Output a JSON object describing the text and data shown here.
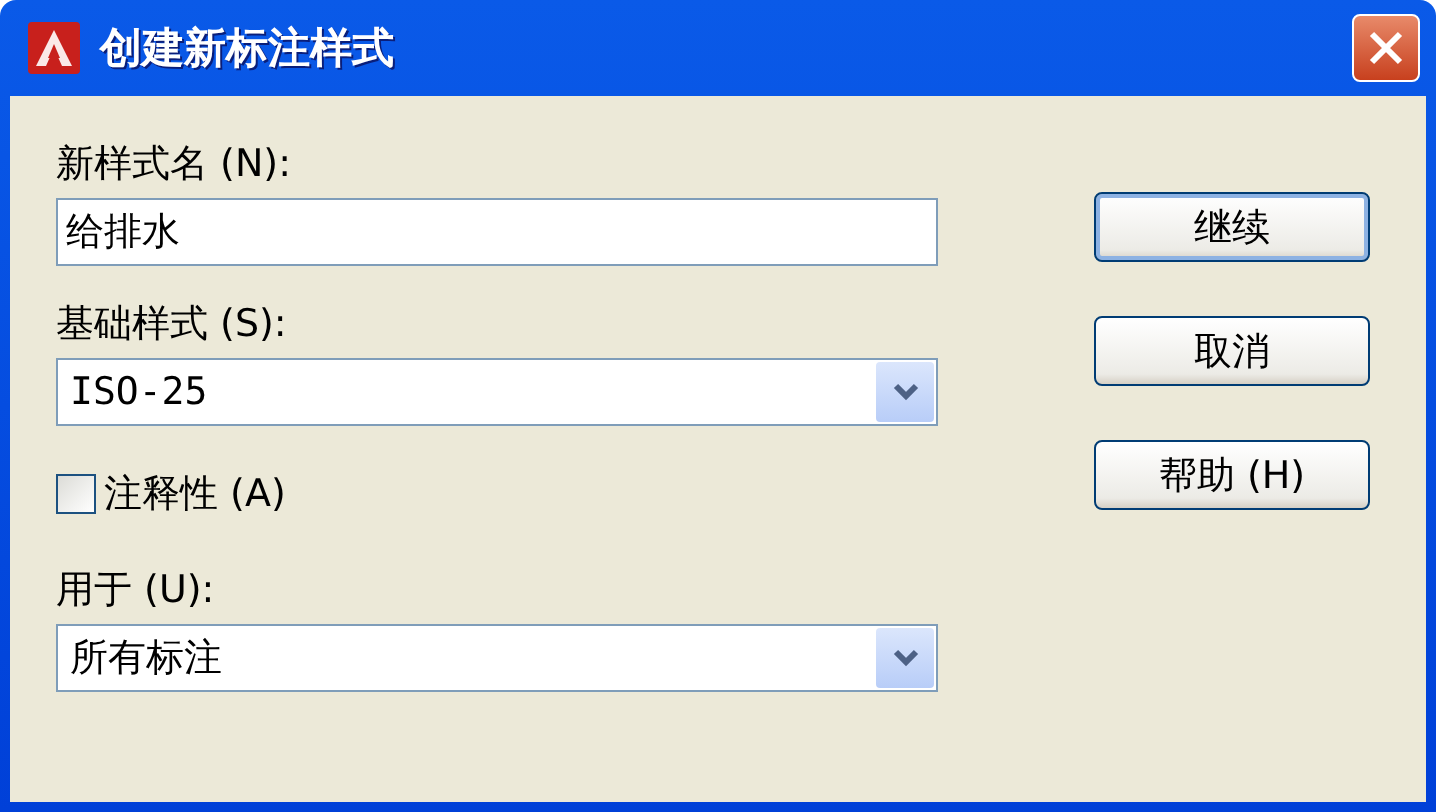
{
  "window": {
    "title": "创建新标注样式"
  },
  "fields": [
    {
      "kind": "text",
      "label": "新样式名 (N):",
      "value": "给排水"
    },
    {
      "kind": "combo",
      "label": "基础样式 (S):",
      "value": "ISO-25"
    },
    {
      "kind": "checkbox",
      "label": "注释性 (A)",
      "checked": false
    },
    {
      "kind": "combo",
      "label": "用于 (U):",
      "value": "所有标注"
    }
  ],
  "buttons": [
    {
      "label": "继续",
      "default": true
    },
    {
      "label": "取消",
      "default": false
    },
    {
      "label": "帮助 (H)",
      "default": false
    }
  ]
}
